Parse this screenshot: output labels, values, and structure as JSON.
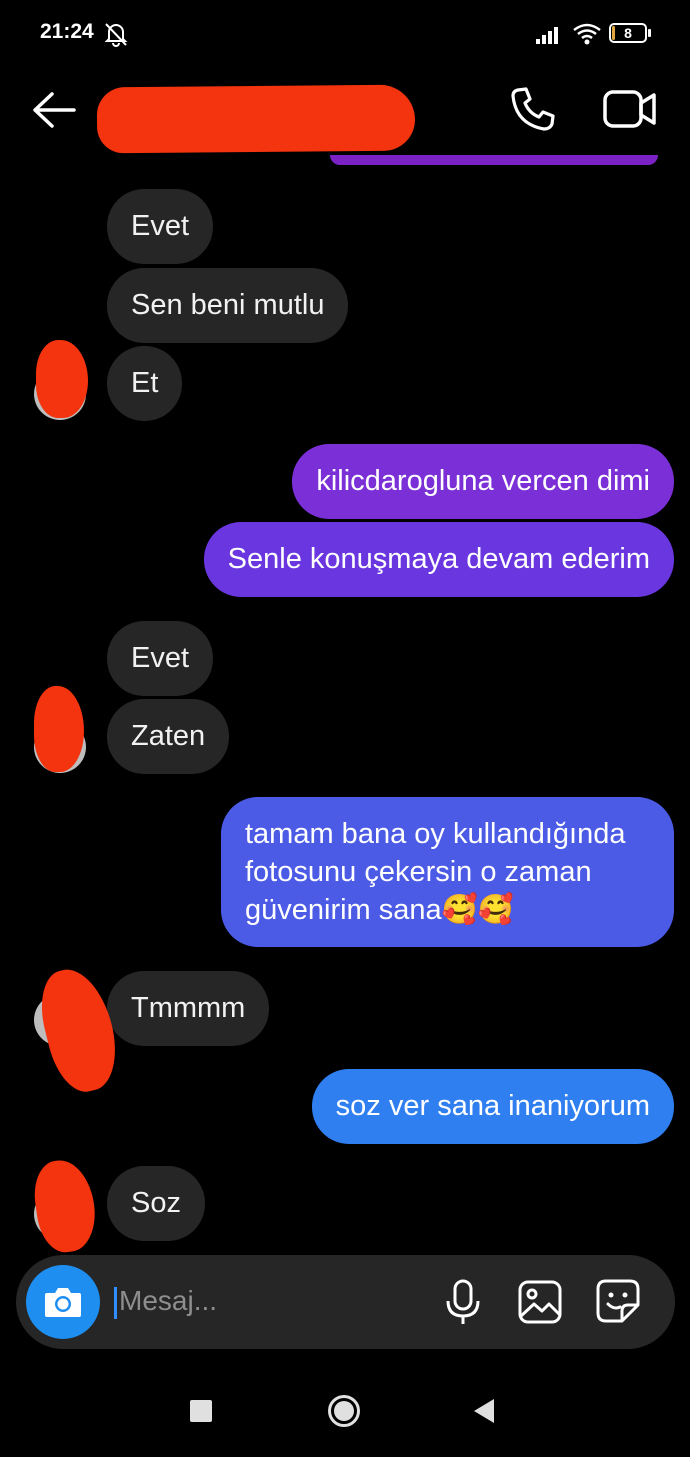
{
  "status_bar": {
    "time": "21:24",
    "battery": "8",
    "battery_level_percent": 8,
    "icons": [
      "bell-off-icon",
      "signal-icon",
      "wifi-icon",
      "battery-icon"
    ]
  },
  "header": {
    "icons": [
      "back-arrow-icon",
      "phone-icon",
      "video-icon"
    ]
  },
  "messages": [
    {
      "sender": "them",
      "text": "Evet"
    },
    {
      "sender": "them",
      "text": "Sen beni mutlu"
    },
    {
      "sender": "them",
      "text": "Et"
    },
    {
      "sender": "me",
      "text": "kilicdarogluna vercen dimi"
    },
    {
      "sender": "me",
      "text": "Senle konuşmaya devam ederim"
    },
    {
      "sender": "them",
      "text": "Evet"
    },
    {
      "sender": "them",
      "text": "Zaten"
    },
    {
      "sender": "me",
      "text": "tamam bana oy kullandığında fotosunu çekersin o zaman güvenirim sana🥰🥰"
    },
    {
      "sender": "them",
      "text": "Tmmmm"
    },
    {
      "sender": "me",
      "text": "soz ver sana inaniyorum"
    },
    {
      "sender": "them",
      "text": "Soz"
    }
  ],
  "colors": {
    "incoming_bubble": "#262626",
    "outgoing_purple": "#7b2fd6",
    "outgoing_violet": "#6a36e0",
    "outgoing_indigo": "#4b5be6",
    "outgoing_blue": "#2f7ff0",
    "redaction": "#f4330f",
    "camera_button": "#1e8ef0"
  },
  "composer": {
    "placeholder": "Mesaj...",
    "icons": [
      "camera-icon",
      "microphone-icon",
      "gallery-icon",
      "sticker-icon"
    ]
  },
  "nav_bar": {
    "icons": [
      "recents-square-icon",
      "home-circle-icon",
      "back-triangle-icon"
    ]
  }
}
